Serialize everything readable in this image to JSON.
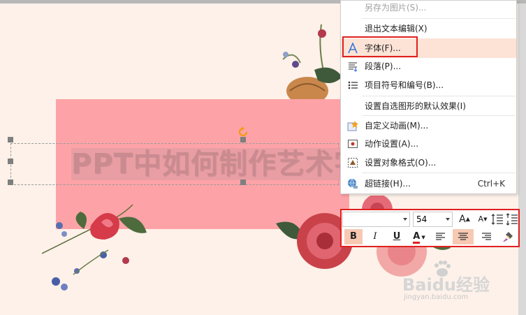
{
  "slide": {
    "title_text": "PPT中如何制作艺术字",
    "background_color": "#fdf1e9",
    "rect_color": "#fda3a7"
  },
  "context_menu": {
    "items": [
      {
        "label": "另存为图片(S)...",
        "icon": "",
        "disabled": true
      },
      {
        "label": "退出文本编辑(X)",
        "icon": ""
      },
      {
        "label": "字体(F)...",
        "icon": "font-a-icon",
        "highlighted": true
      },
      {
        "label": "段落(P)...",
        "icon": "paragraph-icon"
      },
      {
        "label": "项目符号和编号(B)...",
        "icon": "bullet-list-icon"
      },
      {
        "label": "设置自选图形的默认效果(I)",
        "icon": ""
      },
      {
        "label": "自定义动画(M)...",
        "icon": "star-animation-icon"
      },
      {
        "label": "动作设置(A)...",
        "icon": "action-settings-icon"
      },
      {
        "label": "设置对象格式(O)...",
        "icon": "format-object-icon"
      },
      {
        "label": "超链接(H)...",
        "icon": "hyperlink-globe-icon",
        "shortcut": "Ctrl+K"
      }
    ]
  },
  "mini_toolbar": {
    "font_value": "",
    "size_value": "54",
    "grow_font": "A",
    "shrink_font": "A",
    "bold": "B",
    "italic": "I",
    "underline": "U",
    "font_color_letter": "A",
    "font_color": "#e02020",
    "accent_color": "#f7c9b3"
  },
  "watermark": {
    "brand": "Baidu经验",
    "url": "jingyan.baidu.com"
  },
  "annotation_color": "#e02020"
}
